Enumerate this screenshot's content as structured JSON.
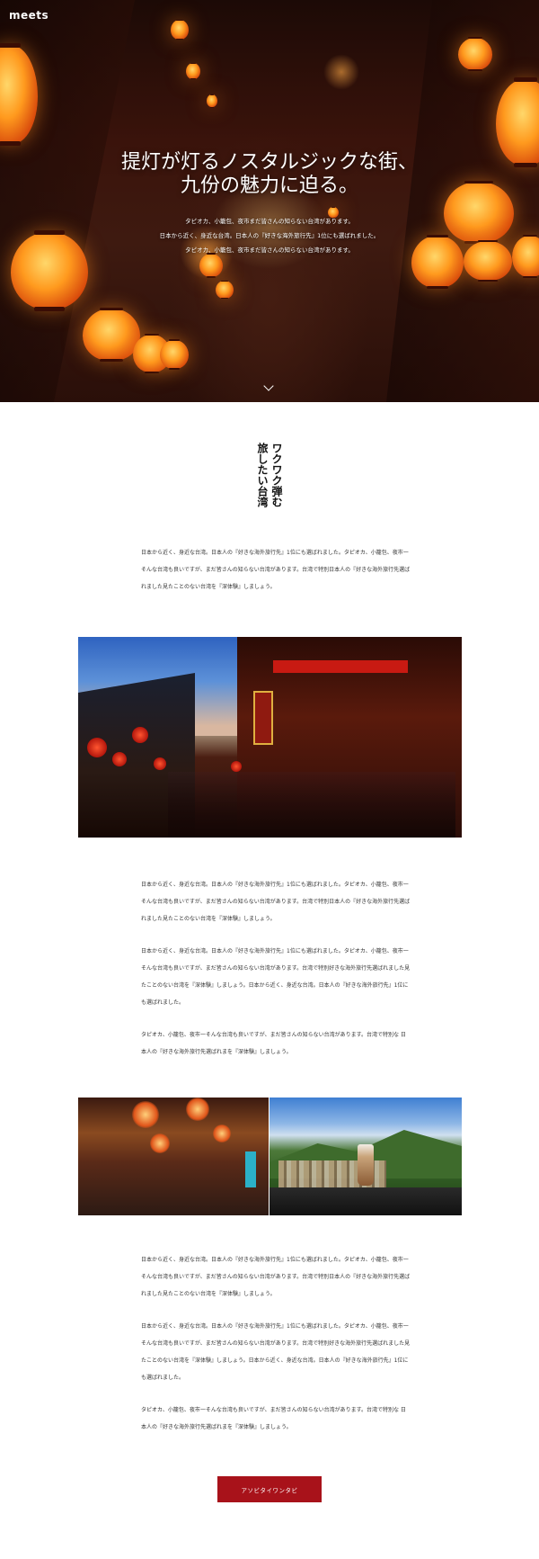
{
  "header": {
    "logo": "meets"
  },
  "hero": {
    "title_line1": "提灯が灯るノスタルジックな街、",
    "title_line2": "九份の魅力に迫る。",
    "lines": [
      "タピオカ、小籠包、夜市まだ皆さんの知らない台湾があります。",
      "日本から近く、身近な台湾。日本人の『好きな海外旅行先』1位にも選ばれました。",
      "タピオカ、小籠包、夜市まだ皆さんの知らない台湾があります。"
    ]
  },
  "heading": {
    "text": "ワクワク弾む旅したい台湾"
  },
  "intro": {
    "paragraph": "日本から近く、身近な台湾。日本人の『好きな海外旅行先』1位にも選ばれました。タピオカ、小籠包、夜市一そんな台湾も良いですが、まだ皆さんの知らない台湾があります。台湾で特別日本人の『好きな海外旅行先選ばれました見たことのない台湾を『深体験』しましょう。"
  },
  "section2": {
    "paragraphs": [
      "日本から近く、身近な台湾。日本人の『好きな海外旅行先』1位にも選ばれました。タピオカ、小籠包、夜市一そんな台湾も良いですが、まだ皆さんの知らない台湾があります。台湾で特別日本人の『好きな海外旅行先選ばれました見たことのない台湾を『深体験』しましょう。",
      "日本から近く、身近な台湾。日本人の『好きな海外旅行先』1位にも選ばれました。タピオカ、小籠包、夜市一そんな台湾も良いですが、まだ皆さんの知らない台湾があります。台湾で特別好きな海外旅行先選ばれました見たことのない台湾を『深体験』しましょう。日本から近く、身近な台湾。日本人の『好きな海外旅行先』1位にも選ばれました。",
      "タピオカ、小籠包、夜市一そんな台湾も良いですが、まだ皆さんの知らない台湾があります。台湾で特別な 日本人の『好きな海外旅行先選ばれまを『深体験』しましょう。"
    ]
  },
  "section3": {
    "paragraphs": [
      "日本から近く、身近な台湾。日本人の『好きな海外旅行先』1位にも選ばれました。タピオカ、小籠包、夜市一そんな台湾も良いですが、まだ皆さんの知らない台湾があります。台湾で特別日本人の『好きな海外旅行先選ばれました見たことのない台湾を『深体験』しましょう。",
      "日本から近く、身近な台湾。日本人の『好きな海外旅行先』1位にも選ばれました。タピオカ、小籠包、夜市一そんな台湾も良いですが、まだ皆さんの知らない台湾があります。台湾で特別好きな海外旅行先選ばれました見たことのない台湾を『深体験』しましょう。日本から近く、身近な台湾。日本人の『好きな海外旅行先』1位にも選ばれました。",
      "タピオカ、小籠包、夜市一そんな台湾も良いですが、まだ皆さんの知らない台湾があります。台湾で特別な 日本人の『好きな海外旅行先選ばれまを『深体験』しましょう。"
    ]
  },
  "cta": {
    "label": "アソビタイワンタビ"
  },
  "icons": {
    "scroll": "chevron-down-icon"
  },
  "colors": {
    "accent": "#a8121a",
    "hero_text": "#ffffff",
    "body_text": "#333333"
  }
}
